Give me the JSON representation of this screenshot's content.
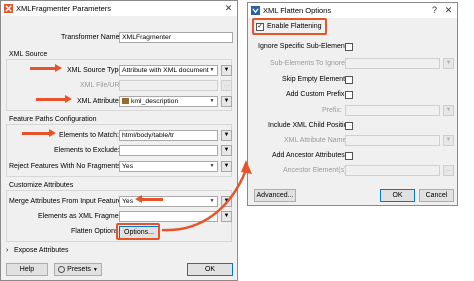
{
  "left_window": {
    "title": "XMLFragmenter Parameters",
    "transformer_name_label": "Transformer Name:",
    "transformer_name_value": "XMLFragmenter",
    "xml_source_section": "XML Source",
    "xml_source_type_label": "XML Source Type:",
    "xml_source_type_value": "Attribute with XML document",
    "xml_file_url_label": "XML File/URL:",
    "xml_attribute_label": "XML Attribute:",
    "xml_attribute_value": "kml_description",
    "feature_paths_section": "Feature Paths Configuration",
    "elements_to_match_label": "Elements to Match:",
    "elements_to_match_value": "html/body/table/tr",
    "elements_to_exclude_label": "Elements to Exclude:",
    "reject_label": "Reject Features With No Fragments:",
    "reject_value": "Yes",
    "customize_section": "Customize Attributes",
    "merge_label": "Merge Attributes From Input Feature:",
    "merge_value": "Yes",
    "elements_as_xml_label": "Elements as XML Fragments:",
    "flatten_options_label": "Flatten Options:",
    "options_button": "Options...",
    "expose_attributes": "Expose Attributes",
    "help_button": "Help",
    "presets_button": "Presets",
    "ok_button": "OK"
  },
  "right_window": {
    "title": "XML Flatten Options",
    "enable_flattening": "Enable Flattening",
    "ignore_specific_label": "Ignore Specific Sub-Elements:",
    "sub_elements_to_ignore_label": "Sub-Elements To Ignore:",
    "skip_empty_label": "Skip Empty Elements:",
    "add_custom_prefix_label": "Add Custom Prefix:",
    "prefix_label": "Prefix:",
    "include_xml_child_label": "Include XML Child Position:",
    "xml_attribute_name_label": "XML Attribute Name:",
    "add_ancestor_label": "Add Ancestor Attributes:",
    "ancestor_elements_label": "Ancestor Element(s):",
    "advanced_button": "Advanced...",
    "ok_button": "OK",
    "cancel_button": "Cancel"
  },
  "colors": {
    "accent_arrow": "#e8542a",
    "window_bg": "#f0f0f0",
    "focus_blue": "#0078d7"
  },
  "icons": [
    "xmlfragmenter-app-icon",
    "fme-app-icon",
    "close-icon",
    "dropdown-arrow-icon",
    "ellipsis-icon",
    "chevron-right-icon",
    "presets-icon",
    "checkmark-icon"
  ]
}
